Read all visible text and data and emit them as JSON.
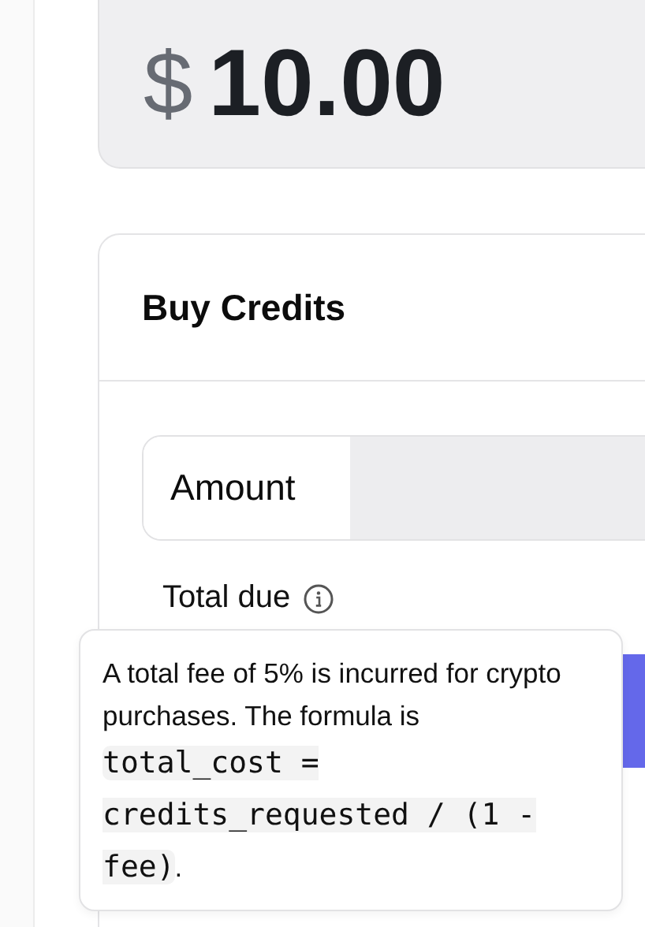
{
  "balance": {
    "currency": "$",
    "amount": "10.00"
  },
  "card": {
    "title": "Buy Credits",
    "amount_label": "Amount",
    "total_label": "Total due"
  },
  "tooltip": {
    "text": "A total fee of 5% is incurred for crypto purchases. The formula is",
    "code": "total_cost = credits_requested / (1 - fee)",
    "suffix": "."
  }
}
